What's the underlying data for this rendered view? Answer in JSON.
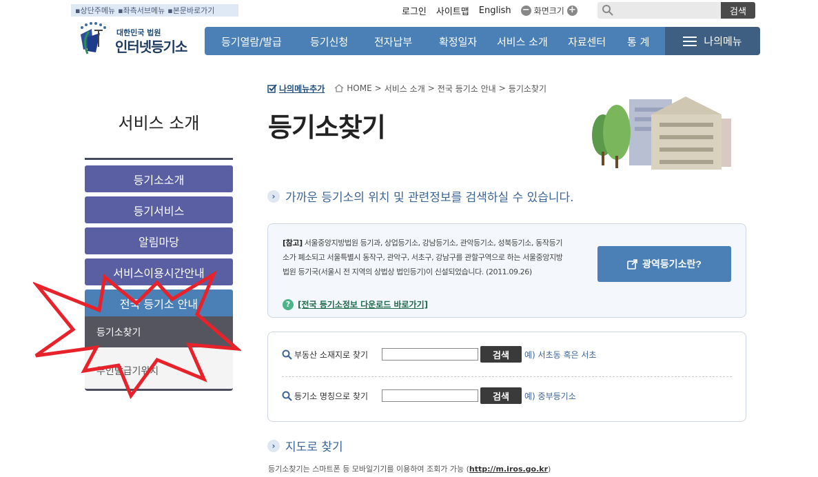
{
  "skip_links": [
    "▪상단주메뉴",
    "▪좌측서브메뉴",
    "▪본문바로가기"
  ],
  "util": {
    "login": "로그인",
    "sitemap": "사이트맵",
    "english": "English",
    "zoom_label": "화면크기",
    "zoom_minus": "−",
    "zoom_plus": "+",
    "search_placeholder": "",
    "search_button": "검색"
  },
  "logo": {
    "sub": "대한민국 법원",
    "main": "인터넷등기소"
  },
  "gnb": [
    "등기열람/발급",
    "등기신청",
    "전자납부",
    "확정일자",
    "서비스 소개",
    "자료센터",
    "통 계"
  ],
  "my_menu": "나의메뉴",
  "sidebar": {
    "title": "서비스 소개",
    "items": [
      "등기소소개",
      "등기서비스",
      "알림마당",
      "서비스이용시간안내",
      "전국 등기소 안내"
    ],
    "sub_items": [
      "등기소찾기",
      "무인발급기위치"
    ]
  },
  "breadcrumb": {
    "add": "나의메뉴추가",
    "path": [
      "HOME",
      "서비스 소개",
      "전국 등기소 안내",
      "등기소찾기"
    ],
    "sep": ">"
  },
  "page_title": "등기소찾기",
  "intro": "가까운 등기소의 위치 및 관련정보를 검색하실 수 있습니다.",
  "notice": {
    "tag": "[참고]",
    "text": " 서울중앙지방법원 등기과, 상업등기소, 강남등기소, 관악등기소, 성북등기소, 동작등기소가 폐소되고 서울특별시 동작구, 관악구, 서초구, 강남구를 관할구역으로 하는 서울중앙지방법원 등기국(서울시 전 지역의 상법상 법인등기)이 신설되었습니다. (2011.09.26)",
    "download": "[전국 등기소정보 다운로드 바로가기]",
    "wide_button": "광역등기소란?"
  },
  "search": {
    "row1": {
      "label": "부동산 소재지로 찾기",
      "button": "검색",
      "example": "예) 서초동 혹은 서초"
    },
    "row2": {
      "label": "등기소 명칭으로 찾기",
      "button": "검색",
      "example": "예) 중부등기소"
    }
  },
  "map_title": "지도로 찾기",
  "mobile": {
    "text": "등기소찾기는 스마트폰 등 모바일기기를 이용하여 조회가 가능 (",
    "link": "http://m.iros.go.kr",
    "end": ")"
  },
  "colors": {
    "gnb": "#4a80b6",
    "lnb": "#5a5fa3",
    "burst": "#e8222a"
  }
}
